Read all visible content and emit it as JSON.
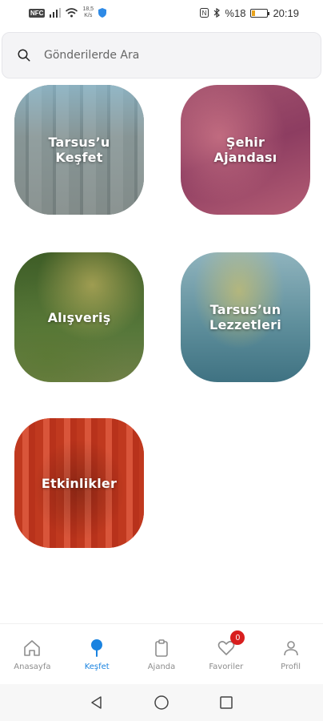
{
  "status_bar": {
    "nfc": "NFC",
    "speed_value": "18,5",
    "speed_unit": "K/s",
    "battery": "%18",
    "time": "20:19",
    "battery_level": 0.18
  },
  "search": {
    "placeholder": "Gönderilerde Ara",
    "value": ""
  },
  "tiles": [
    {
      "label": "Tarsus’u\nKeşfet"
    },
    {
      "label": "Şehir\nAjandası"
    },
    {
      "label": "Alışveriş"
    },
    {
      "label": "Tarsus’un\nLezzetleri"
    },
    {
      "label": "Etkinlikler"
    }
  ],
  "bottom_nav": {
    "items": [
      {
        "label": "Anasayfa",
        "icon": "home-icon"
      },
      {
        "label": "Keşfet",
        "icon": "pin-icon",
        "active": true
      },
      {
        "label": "Ajanda",
        "icon": "clipboard-icon"
      },
      {
        "label": "Favoriler",
        "icon": "heart-icon",
        "badge": "0"
      },
      {
        "label": "Profil",
        "icon": "user-icon"
      }
    ]
  },
  "colors": {
    "accent": "#1a83e0",
    "badge": "#d81e1e",
    "inactive": "#8d8d8d"
  }
}
